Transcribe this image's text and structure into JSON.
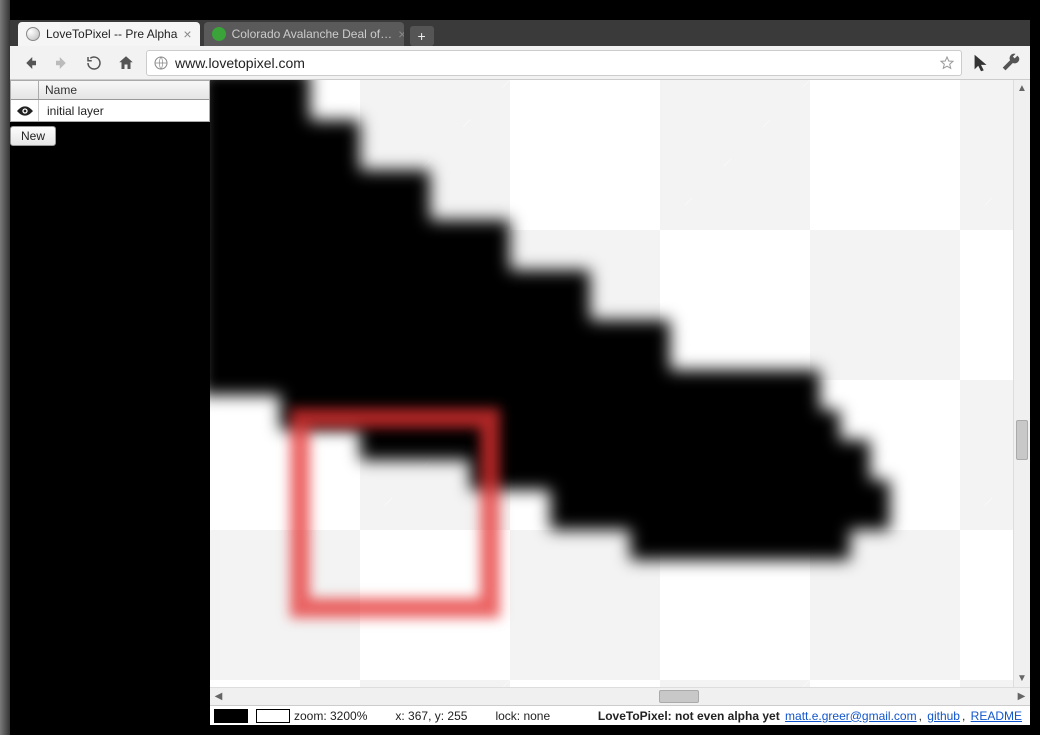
{
  "browser": {
    "tabs": [
      {
        "title": "LoveToPixel -- Pre Alpha",
        "active": true
      },
      {
        "title": "Colorado Avalanche Deal of…",
        "active": false
      }
    ],
    "newtab_label": "+",
    "url": "www.lovetopixel.com"
  },
  "layers": {
    "header_name": "Name",
    "items": [
      {
        "visible": true,
        "name": "initial layer"
      }
    ],
    "new_button": "New"
  },
  "status": {
    "zoom_label": "zoom: 3200%",
    "coords_label": "x: 367, y: 255",
    "lock_label": "lock: none",
    "tagline": "LoveToPixel: not even alpha yet",
    "email": "matt.e.greer@gmail.com",
    "link_github": "github",
    "link_readme": "README"
  }
}
